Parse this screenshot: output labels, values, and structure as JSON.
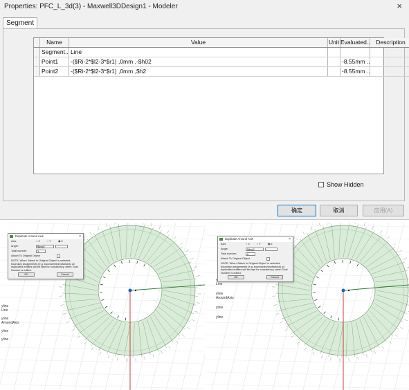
{
  "dialog": {
    "title": "Properties: PFC_L_3d(3) - Maxwell3DDesign1 - Modeler",
    "close_glyph": "×",
    "tab": "Segment",
    "columns": [
      "Name",
      "Value",
      "Unit",
      "Evaluated...",
      "Description"
    ],
    "rows": [
      {
        "name": "Segment...",
        "value": "Line",
        "unit": "",
        "evaluated": "",
        "description": ""
      },
      {
        "name": "Point1",
        "value": "-($Ri-2*$l2-3*$r1) ,0mm ,-$h02",
        "unit": "",
        "evaluated": "-8.55mm ...",
        "description": ""
      },
      {
        "name": "Point2",
        "value": "-($Ri-2*$l2-3*$r1) ,0mm ,$h2",
        "unit": "",
        "evaluated": "-8.55mm ...",
        "description": ""
      }
    ],
    "show_hidden": "Show Hidden",
    "ok_label": "确定",
    "cancel_label": "取消",
    "apply_label": "应用(A)"
  },
  "views": [
    {
      "tree": [
        "yline",
        "Line",
        "",
        "yline",
        "AroundAxis",
        "",
        "yline",
        "",
        "yline"
      ],
      "popup": {
        "title": "Duplicate Around Axis",
        "axis_label": "Axis:",
        "axis_x": "X",
        "axis_y": "Y",
        "axis_z": "Z",
        "angle_label": "Angle:",
        "angle_value": "$deg2",
        "total_label": "Total number:",
        "total_value": "3",
        "attach_label": "Attach To Original Object",
        "note": "NOTE: When 'Attach to Original Object' is selected, boundary assignments (e.g. boundaries/excitations) on duplicated entities will be kept for consistency, when Total Number is edited.",
        "ok": "OK",
        "cancel": "Cancel"
      }
    },
    {
      "tree": [
        "yline",
        "Line",
        "",
        "yline",
        "AroundAxis",
        "",
        "yline",
        "",
        "yline"
      ],
      "popup": {
        "title": "Duplicate Around Axis",
        "axis_label": "Axis:",
        "axis_x": "X",
        "axis_y": "Y",
        "axis_z": "Z",
        "angle_label": "Angle:",
        "angle_value": "$deg2",
        "total_label": "Total number:",
        "total_value": "8",
        "attach_label": "Attach To Original Object",
        "note": "NOTE: When 'Attach to Original Object' is selected, boundary assignments (e.g. boundaries/excitations) on duplicated entities will be kept for consistency, when Total Number is edited.",
        "ok": "OK",
        "cancel": "Cancel"
      }
    }
  ],
  "colors": {
    "ring_fill": "#d9ecd8",
    "ring_stroke": "#7a9a7a",
    "axis_x": "#c62828",
    "axis_y": "#2e7d32",
    "axis_z": "#1565c0"
  }
}
